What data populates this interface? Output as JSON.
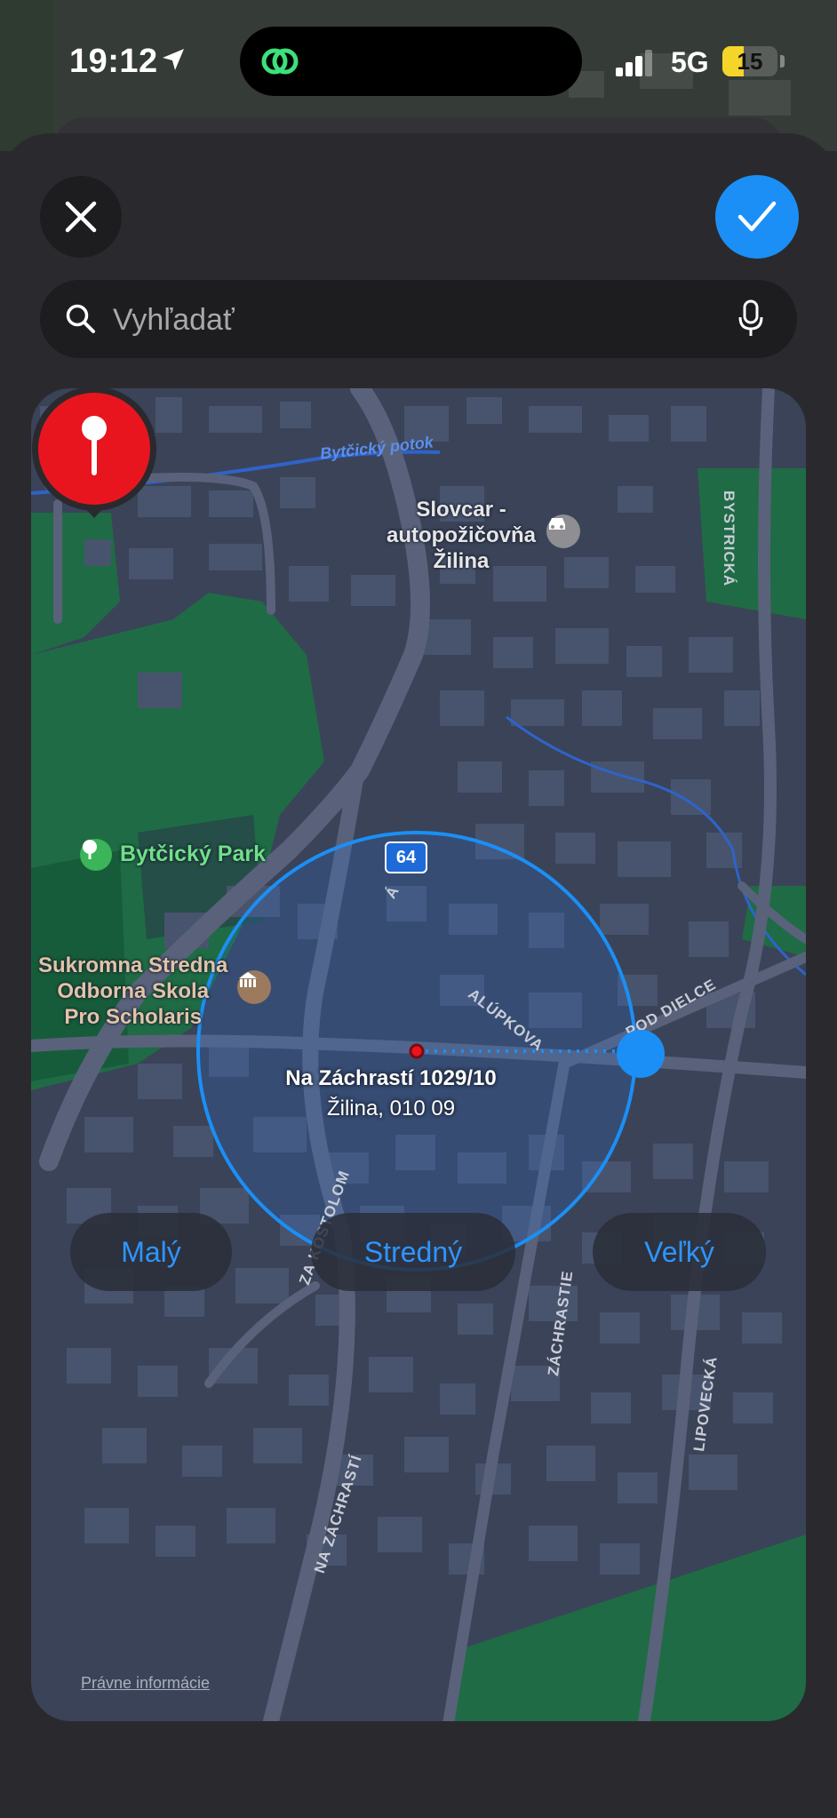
{
  "status_bar": {
    "time": "19:12",
    "network": "5G",
    "battery": "15",
    "battery_level_percent": 15
  },
  "toolbar": {
    "close_icon": "xmark-icon",
    "confirm_icon": "checkmark-icon"
  },
  "search": {
    "placeholder": "Vyhľadať",
    "value": ""
  },
  "map": {
    "places": {
      "car_rental_line1": "Slovcar -",
      "car_rental_line2": "autopožičovňa",
      "car_rental_line3": "Žilina",
      "park": "Bytčický Park",
      "school_line1": "Sukromna Stredna",
      "school_line2": "Odborna Skola",
      "school_line3": "Pro Scholaris"
    },
    "route_shield": "64",
    "water": "Bytčický potok",
    "streets": {
      "bystricka": "BYSTRICKÁ",
      "alupkova": "ALÚPKOVA",
      "pod_dielce": "POD DIELCE",
      "za_kostolom": "ZA KOSTOLOM",
      "zachrastie": "ZÁCHRASTIE",
      "lipovecka": "LIPOVECKÁ",
      "na_zachrasti": "NA ZÁCHRASTÍ",
      "partial_a": "Á"
    },
    "pin": {
      "address_line1": "Na Záchrastí 1029/10",
      "address_line2": "Žilina, 010 09"
    },
    "legal_link": "Právne informácie",
    "accent": "#1b8ff5",
    "pin_color": "#e8151f",
    "park_color": "#3bb45a"
  },
  "radius_options": [
    {
      "label": "Malý"
    },
    {
      "label": "Stredný"
    },
    {
      "label": "Veľký"
    }
  ]
}
